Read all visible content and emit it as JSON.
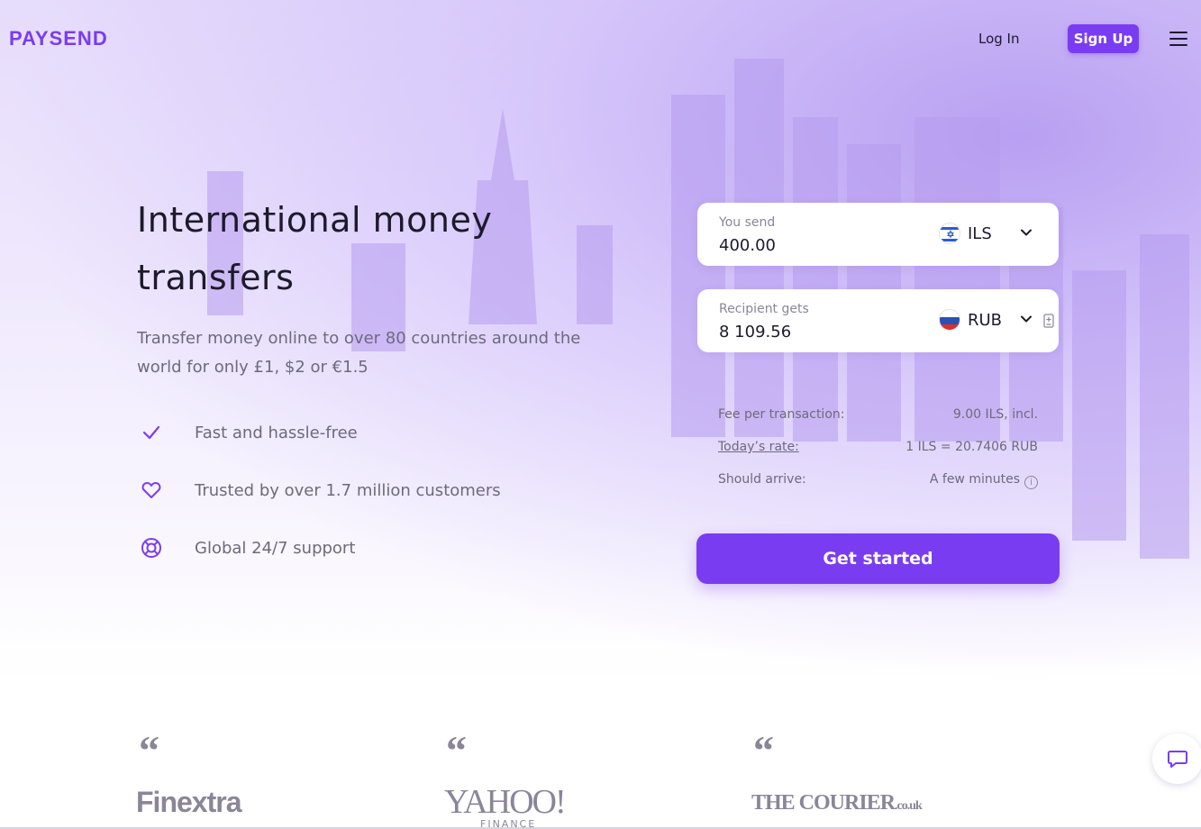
{
  "header": {
    "logo": "PAYSEND",
    "login": "Log In",
    "signup": "Sign Up",
    "menu_icon": "hamburger-menu-icon"
  },
  "hero": {
    "title": "International money transfers",
    "subtitle": "Transfer money online to over 80 countries around the world for only £1, $2 or €1.5",
    "features": [
      {
        "icon": "check-icon",
        "text": "Fast and hassle-free"
      },
      {
        "icon": "heart-icon",
        "text": "Trusted by over 1.7 million customers"
      },
      {
        "icon": "lifebuoy-icon",
        "text": "Global 24/7 support"
      }
    ]
  },
  "converter": {
    "send": {
      "label": "You send",
      "value": "400.00",
      "currency": "ILS",
      "flag": "israel-flag-icon"
    },
    "receive": {
      "label": "Recipient gets",
      "value": "8 109.56",
      "currency": "RUB",
      "flag": "russia-flag-icon"
    },
    "fee_label": "Fee per transaction:",
    "fee_value": "9.00 ILS, incl.",
    "rate_label": "Today’s rate:",
    "rate_value": "1 ILS = 20.7406 RUB",
    "arrive_label": "Should arrive:",
    "arrive_value": "A few minutes",
    "info_glyph": "i",
    "cta": "Get started"
  },
  "press": {
    "quote_mark": "“",
    "finextra": "Finextra",
    "yahoo": "YAHOO!",
    "yahoo_sub": "FINANCE",
    "courier": "THE COURIER",
    "courier_suffix": ".co.uk"
  },
  "colors": {
    "brand": "#7a3cf0",
    "text": "#1d1a2b",
    "muted": "#6e6a7c"
  }
}
